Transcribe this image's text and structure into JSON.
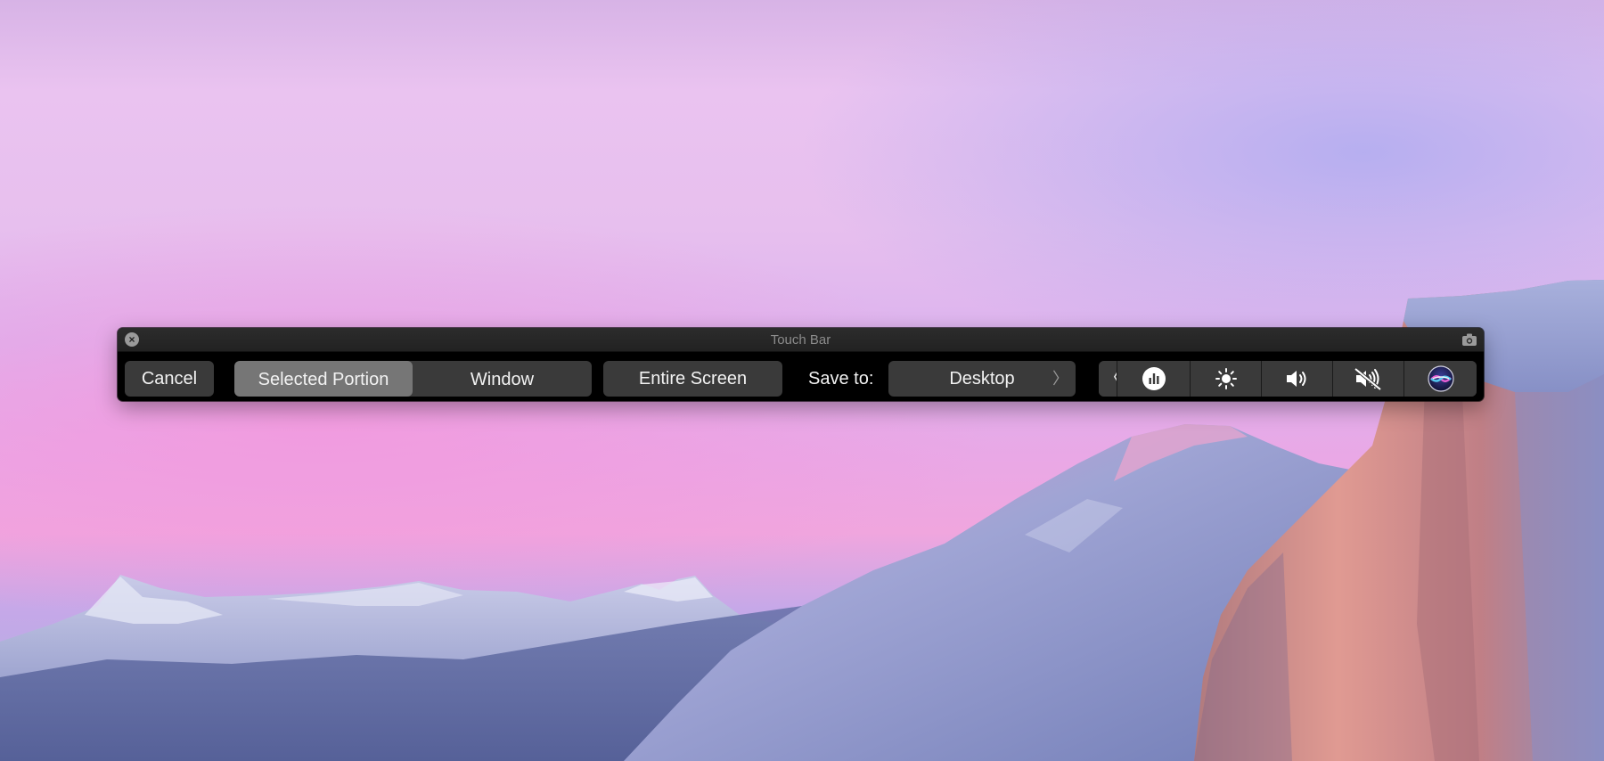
{
  "window": {
    "title": "Touch Bar",
    "close_icon": "close-icon",
    "screenshot_icon": "camera-icon"
  },
  "bar": {
    "cancel_label": "Cancel",
    "capture_modes": [
      {
        "label": "Selected Portion",
        "selected": true
      },
      {
        "label": "Window",
        "selected": false
      }
    ],
    "entire_screen_label": "Entire Screen",
    "save_to_label": "Save to:",
    "save_destination": "Desktop",
    "save_chevron": "〉"
  },
  "control_strip": {
    "collapse_glyph": "〈",
    "items": [
      {
        "name": "analytics",
        "icon": "bar-chart-icon"
      },
      {
        "name": "brightness",
        "icon": "sun-icon"
      },
      {
        "name": "volume",
        "icon": "speaker-icon"
      },
      {
        "name": "mute",
        "icon": "speaker-muted-icon"
      },
      {
        "name": "siri",
        "icon": "siri-icon"
      }
    ]
  },
  "colors": {
    "bar_background": "#000000",
    "button": "#3a3a3a",
    "selected_segment": "#767676",
    "text": "#f2f2f2"
  }
}
